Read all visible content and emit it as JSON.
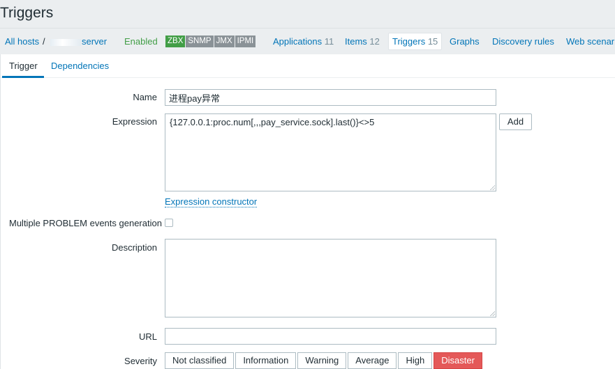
{
  "page": {
    "title": "Triggers"
  },
  "nav": {
    "all_hosts": "All hosts",
    "separator": "/",
    "host_name": "server",
    "status": "Enabled",
    "availability": [
      "ZBX",
      "SNMP",
      "JMX",
      "IPMI"
    ],
    "applications": {
      "label": "Applications",
      "count": "11"
    },
    "items": {
      "label": "Items",
      "count": "12"
    },
    "triggers": {
      "label": "Triggers",
      "count": "15"
    },
    "graphs": "Graphs",
    "discovery": "Discovery rules",
    "web": "Web scenari"
  },
  "tabs": {
    "trigger": "Trigger",
    "dependencies": "Dependencies"
  },
  "form": {
    "name_label": "Name",
    "name_value": "进程pay异常",
    "expression_label": "Expression",
    "expression_value": "{127.0.0.1:proc.num[,,,pay_service.sock].last()}<>5",
    "add_button": "Add",
    "expression_constructor": "Expression constructor",
    "multiple_label": "Multiple PROBLEM events generation",
    "description_label": "Description",
    "description_value": "",
    "url_label": "URL",
    "url_value": "",
    "severity_label": "Severity",
    "severity_options": [
      "Not classified",
      "Information",
      "Warning",
      "Average",
      "High",
      "Disaster"
    ],
    "severity_selected": "Disaster"
  },
  "colors": {
    "accent": "#0275b8",
    "enabled": "#429e47",
    "disaster": "#e45959"
  }
}
